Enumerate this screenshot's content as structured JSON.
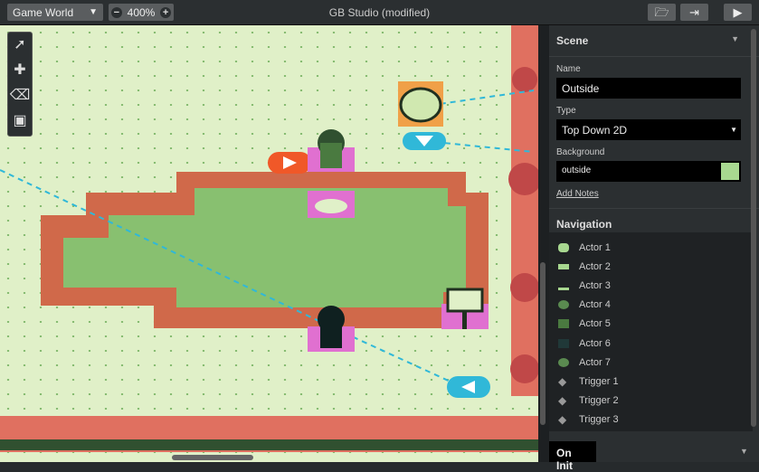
{
  "toolbar": {
    "world_select": "Game World",
    "zoom": "400%",
    "title": "GB Studio (modified)",
    "buttons": [
      "folder-open-icon",
      "export-icon",
      "play-icon"
    ]
  },
  "tools": [
    "select-icon",
    "add-icon",
    "eraser-icon",
    "cube-icon"
  ],
  "scene": {
    "header": "Scene",
    "name_label": "Name",
    "name_value": "Outside",
    "type_label": "Type",
    "type_value": "Top Down 2D",
    "background_label": "Background",
    "background_value": "outside",
    "add_notes": "Add Notes"
  },
  "navigation": {
    "header": "Navigation",
    "items": [
      {
        "label": "Actor 1",
        "icon": "bush-icon"
      },
      {
        "label": "Actor 2",
        "icon": "sign-icon"
      },
      {
        "label": "Actor 3",
        "icon": "duck-icon"
      },
      {
        "label": "Actor 4",
        "icon": "npc-icon"
      },
      {
        "label": "Actor 5",
        "icon": "npc-icon"
      },
      {
        "label": "Actor 6",
        "icon": "npc-icon"
      },
      {
        "label": "Actor 7",
        "icon": "npc-icon"
      },
      {
        "label": "Trigger 1",
        "icon": "diamond-icon"
      },
      {
        "label": "Trigger 2",
        "icon": "diamond-icon"
      },
      {
        "label": "Trigger 3",
        "icon": "diamond-icon"
      }
    ]
  },
  "on_init": "On Init",
  "colors": {
    "grass": "#e0f0c8",
    "pond_edge": "#d0694a",
    "pond": "#88c070",
    "trigger": "#e070d0",
    "connection": "#30b8d8",
    "arrow_orange": "#f05828"
  }
}
